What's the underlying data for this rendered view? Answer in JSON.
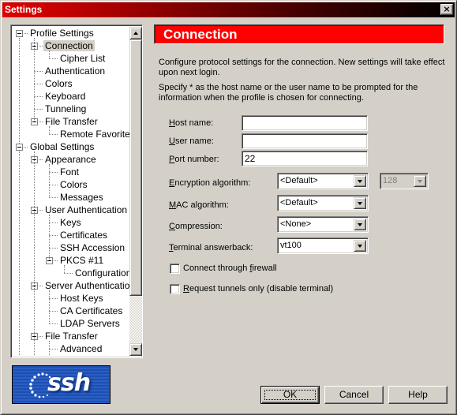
{
  "window": {
    "title": "Settings",
    "close_label": "×"
  },
  "tree": {
    "items": [
      {
        "label": "Profile Settings",
        "level": 0,
        "expandable": true,
        "selected": false
      },
      {
        "label": "Connection",
        "level": 1,
        "expandable": true,
        "selected": true
      },
      {
        "label": "Cipher List",
        "level": 2,
        "expandable": false,
        "selected": false
      },
      {
        "label": "Authentication",
        "level": 1,
        "expandable": false,
        "selected": false
      },
      {
        "label": "Colors",
        "level": 1,
        "expandable": false,
        "selected": false
      },
      {
        "label": "Keyboard",
        "level": 1,
        "expandable": false,
        "selected": false
      },
      {
        "label": "Tunneling",
        "level": 1,
        "expandable": false,
        "selected": false
      },
      {
        "label": "File Transfer",
        "level": 1,
        "expandable": true,
        "selected": false
      },
      {
        "label": "Remote Favorites",
        "level": 2,
        "expandable": false,
        "selected": false
      },
      {
        "label": "Global Settings",
        "level": 0,
        "expandable": true,
        "selected": false
      },
      {
        "label": "Appearance",
        "level": 1,
        "expandable": true,
        "selected": false
      },
      {
        "label": "Font",
        "level": 2,
        "expandable": false,
        "selected": false
      },
      {
        "label": "Colors",
        "level": 2,
        "expandable": false,
        "selected": false
      },
      {
        "label": "Messages",
        "level": 2,
        "expandable": false,
        "selected": false
      },
      {
        "label": "User Authentication",
        "level": 1,
        "expandable": true,
        "selected": false
      },
      {
        "label": "Keys",
        "level": 2,
        "expandable": false,
        "selected": false
      },
      {
        "label": "Certificates",
        "level": 2,
        "expandable": false,
        "selected": false
      },
      {
        "label": "SSH Accession",
        "level": 2,
        "expandable": false,
        "selected": false
      },
      {
        "label": "PKCS #11",
        "level": 2,
        "expandable": true,
        "selected": false
      },
      {
        "label": "Configuration",
        "level": 3,
        "expandable": false,
        "selected": false
      },
      {
        "label": "Server Authentication",
        "level": 1,
        "expandable": true,
        "selected": false
      },
      {
        "label": "Host Keys",
        "level": 2,
        "expandable": false,
        "selected": false
      },
      {
        "label": "CA Certificates",
        "level": 2,
        "expandable": false,
        "selected": false
      },
      {
        "label": "LDAP Servers",
        "level": 2,
        "expandable": false,
        "selected": false
      },
      {
        "label": "File Transfer",
        "level": 1,
        "expandable": true,
        "selected": false
      },
      {
        "label": "Advanced",
        "level": 2,
        "expandable": false,
        "selected": false
      }
    ],
    "scroll_fraction_visible": 0.82
  },
  "logo": {
    "text": "ssh",
    "bg_color": "#1e4fb0"
  },
  "panel": {
    "title": "Connection",
    "header_color": "#ff0000",
    "description_1": "Configure protocol settings for the connection. New settings will take effect upon next login.",
    "description_2": "Specify * as the host name or the user name to be prompted for the information when the profile is chosen for connecting."
  },
  "fields": {
    "host_name": {
      "label_accel": "H",
      "label_rest": "ost name:",
      "value": ""
    },
    "user_name": {
      "label_accel": "U",
      "label_rest": "ser name:",
      "value": ""
    },
    "port_number": {
      "label_accel": "P",
      "label_rest": "ort number:",
      "value": "22"
    }
  },
  "combos": {
    "encryption": {
      "label_accel": "E",
      "label_rest": "ncryption algorithm:",
      "value": "<Default>"
    },
    "key_length": {
      "value": "128",
      "disabled": true
    },
    "mac": {
      "label_accel": "M",
      "label_rest": "AC algorithm:",
      "value": "<Default>"
    },
    "compression": {
      "label_accel": "C",
      "label_rest": "ompression:",
      "value": "<None>"
    },
    "terminal_answerback": {
      "label_accel": "T",
      "label_rest": "erminal answerback:",
      "value": "vt100"
    }
  },
  "checkboxes": {
    "firewall": {
      "label_pre": "Connect through ",
      "label_accel": "f",
      "label_post": "irewall",
      "checked": false
    },
    "tunnels_only": {
      "label_pre": "",
      "label_accel": "R",
      "label_post": "equest tunnels only (disable terminal)",
      "checked": false
    }
  },
  "buttons": {
    "ok": "OK",
    "cancel": "Cancel",
    "help": "Help"
  }
}
